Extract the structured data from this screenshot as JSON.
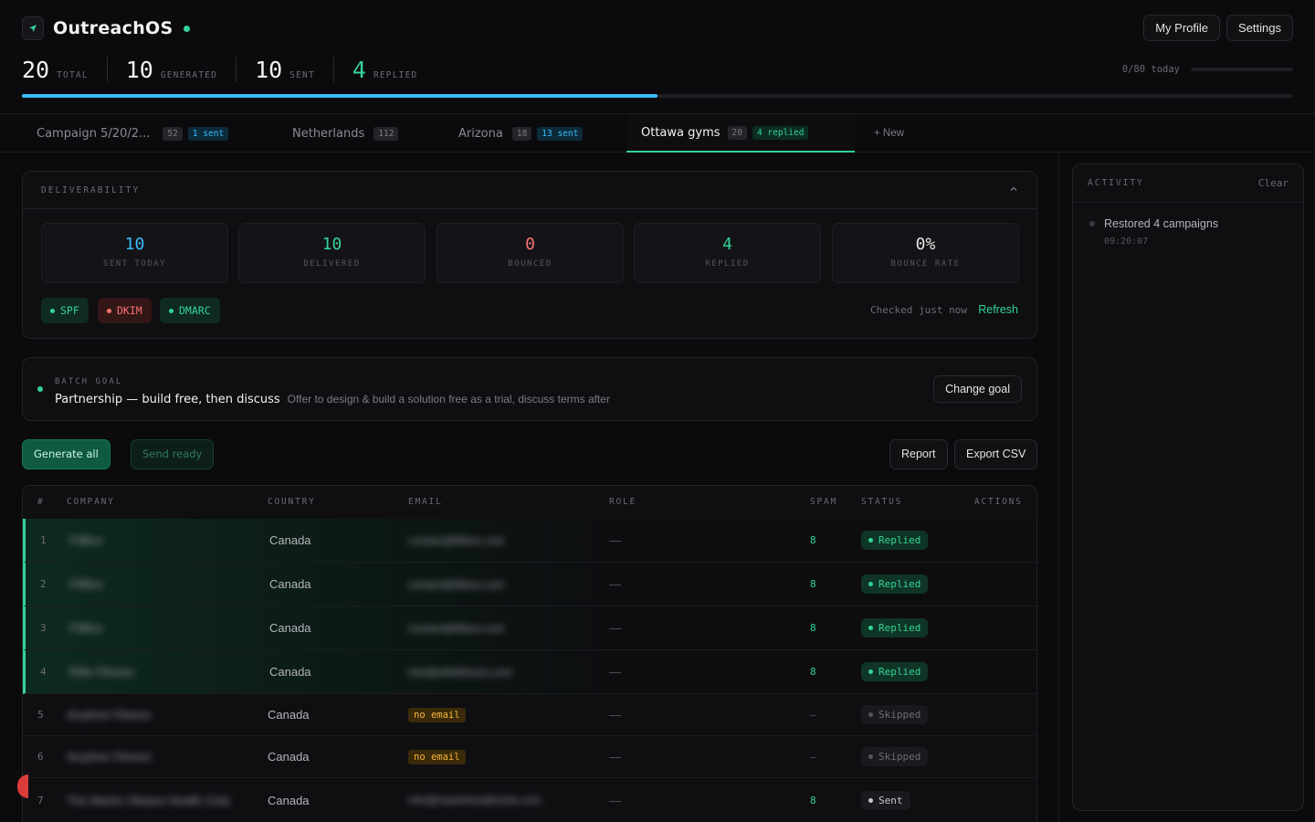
{
  "app": {
    "title": "OutreachOS"
  },
  "header": {
    "profile_label": "My Profile",
    "settings_label": "Settings",
    "today_label": "0/80 today"
  },
  "stats": [
    {
      "value": "20",
      "label": "TOTAL"
    },
    {
      "value": "10",
      "label": "GENERATED"
    },
    {
      "value": "10",
      "label": "SENT"
    },
    {
      "value": "4",
      "label": "REPLIED"
    }
  ],
  "progress": {
    "sent_fraction": 0.5
  },
  "tabs": [
    {
      "label": "Campaign 5/20/2...",
      "count": "52",
      "badge": "1 sent"
    },
    {
      "label": "Netherlands",
      "count": "112",
      "badge": ""
    },
    {
      "label": "Arizona",
      "count": "18",
      "badge": "13 sent"
    },
    {
      "label": "Ottawa gyms",
      "count": "20",
      "badge": "4 replied"
    }
  ],
  "new_tab_label": "+ New",
  "deliverability": {
    "title": "DELIVERABILITY",
    "metrics": [
      {
        "value": "10",
        "label": "SENT TODAY",
        "color": "#38bdf8"
      },
      {
        "value": "10",
        "label": "DELIVERED",
        "color": "#34d399"
      },
      {
        "value": "0",
        "label": "BOUNCED",
        "color": "#f87171"
      },
      {
        "value": "4",
        "label": "REPLIED",
        "color": "#34d399"
      },
      {
        "value": "0%",
        "label": "BOUNCE RATE",
        "color": "#e4e4e4"
      }
    ],
    "auth": [
      {
        "label": "SPF",
        "color": "#34d399"
      },
      {
        "label": "DKIM",
        "color": "#f87171"
      },
      {
        "label": "DMARC",
        "color": "#34d399"
      }
    ],
    "checked_text": "Checked just now",
    "refresh_label": "Refresh"
  },
  "batch_goal": {
    "label": "BATCH GOAL",
    "title": "Partnership — build free, then discuss",
    "description": "Offer to design & build a solution free as a trial, discuss terms after",
    "change_label": "Change goal"
  },
  "actions": {
    "generate_all": "Generate all",
    "send_ready": "Send ready",
    "report": "Report",
    "export_csv": "Export CSV"
  },
  "table": {
    "columns": [
      "#",
      "COMPANY",
      "COUNTRY",
      "EMAIL",
      "ROLE",
      "SPAM",
      "STATUS",
      "ACTIONS"
    ],
    "rows": [
      {
        "num": "1",
        "company": "FitBox",
        "country": "Canada",
        "email": "contact@fitbox.com",
        "role": "—",
        "spam": "8",
        "status": "Replied"
      },
      {
        "num": "2",
        "company": "FitBox",
        "country": "Canada",
        "email": "contact@fitbox.com",
        "role": "—",
        "spam": "8",
        "status": "Replied"
      },
      {
        "num": "3",
        "company": "FitBox",
        "country": "Canada",
        "email": "contact@fitbox.com",
        "role": "—",
        "spam": "8",
        "status": "Replied"
      },
      {
        "num": "4",
        "company": "Elite Fitness",
        "country": "Canada",
        "email": "info@elitefitness.com",
        "role": "—",
        "spam": "8",
        "status": "Replied"
      },
      {
        "num": "5",
        "company": "Anytime Fitness",
        "country": "Canada",
        "email": "no email",
        "role": "—",
        "spam": "–",
        "status": "Skipped"
      },
      {
        "num": "6",
        "company": "Anytime Fitness",
        "country": "Canada",
        "email": "no email",
        "role": "—",
        "spam": "–",
        "status": "Skipped"
      },
      {
        "num": "7",
        "company": "The Martin Ottawa Health Club",
        "country": "Canada",
        "email": "info@martinhealthclub.com",
        "role": "—",
        "spam": "8",
        "status": "Sent"
      }
    ]
  },
  "activity": {
    "title": "ACTIVITY",
    "clear_label": "Clear",
    "items": [
      {
        "text": "Restored 4 campaigns",
        "time": "09:20:07"
      }
    ]
  }
}
